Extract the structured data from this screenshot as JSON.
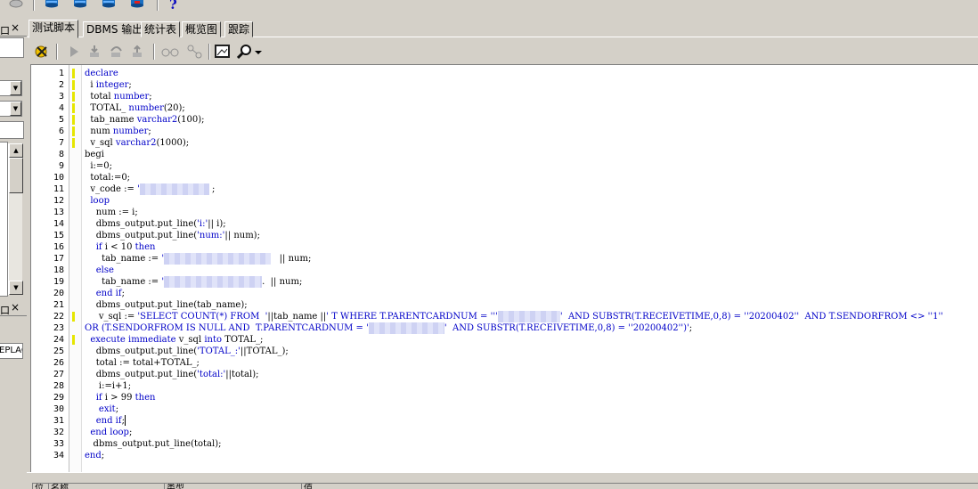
{
  "toolbar": {
    "icons": [
      "disk-icon",
      "database-icon",
      "database-icon",
      "database-icon",
      "database-icon",
      "help-icon"
    ],
    "help_label": "?"
  },
  "left_panel": {
    "top_header_glyph": "口",
    "bottom_header_glyph": "口",
    "close_glyph": "×",
    "replace_tab_label": "EPLAC"
  },
  "tabs": [
    {
      "label": "测试脚本",
      "active": true
    },
    {
      "label": "DBMS 输出",
      "active": false
    },
    {
      "label": "统计表",
      "active": false
    },
    {
      "label": "概览图",
      "active": false
    },
    {
      "label": "跟踪",
      "active": false
    }
  ],
  "editor_toolbar": {
    "icons": [
      "debug-start-icon",
      "run-icon",
      "step-into-icon",
      "step-over-icon",
      "step-out-icon",
      "glasses-icon",
      "breakpoint-icon",
      "image-icon",
      "find-icon",
      "dropdown-arrow-icon"
    ]
  },
  "editor": {
    "modified_lines": [
      1,
      2,
      3,
      4,
      5,
      6,
      7,
      22,
      24
    ],
    "lines": [
      [
        {
          "t": "declare",
          "c": "kw"
        }
      ],
      [
        {
          "t": "  i "
        },
        {
          "t": "integer",
          "c": "kw"
        },
        {
          "t": ";"
        }
      ],
      [
        {
          "t": "  total "
        },
        {
          "t": "number",
          "c": "kw"
        },
        {
          "t": ";"
        }
      ],
      [
        {
          "t": "  TOTAL_ "
        },
        {
          "t": "number",
          "c": "kw"
        },
        {
          "t": "(20);"
        }
      ],
      [
        {
          "t": "  tab_name "
        },
        {
          "t": "varchar2",
          "c": "kw"
        },
        {
          "t": "(100);"
        }
      ],
      [
        {
          "t": "  num "
        },
        {
          "t": "number",
          "c": "kw"
        },
        {
          "t": ";"
        }
      ],
      [
        {
          "t": "  v_sql "
        },
        {
          "t": "varchar2",
          "c": "kw"
        },
        {
          "t": "(1000);"
        }
      ],
      [
        {
          "t": "begi"
        }
      ],
      [
        {
          "t": "  i:=0;"
        }
      ],
      [
        {
          "t": "  total:=0;"
        }
      ],
      [
        {
          "t": "  v_code := "
        },
        {
          "t": "'",
          "c": "str"
        },
        {
          "t": "",
          "blur": 78
        },
        {
          "t": " ;"
        }
      ],
      [
        {
          "t": "  "
        },
        {
          "t": "loop",
          "c": "kw"
        }
      ],
      [
        {
          "t": "    num := i;"
        }
      ],
      [
        {
          "t": "    dbms_output.put_line("
        },
        {
          "t": "'i:'",
          "c": "str"
        },
        {
          "t": "|| i);"
        }
      ],
      [
        {
          "t": "    dbms_output.put_line("
        },
        {
          "t": "'num:'",
          "c": "str"
        },
        {
          "t": "|| num);"
        }
      ],
      [
        {
          "t": "    "
        },
        {
          "t": "if",
          "c": "kw"
        },
        {
          "t": " i < 10 "
        },
        {
          "t": "then",
          "c": "kw"
        }
      ],
      [
        {
          "t": "      tab_name := "
        },
        {
          "t": "'",
          "c": "str"
        },
        {
          "t": "",
          "blur": 120
        },
        {
          "t": "   || num;"
        }
      ],
      [
        {
          "t": "    "
        },
        {
          "t": "else",
          "c": "kw"
        }
      ],
      [
        {
          "t": "      tab_name := "
        },
        {
          "t": "'",
          "c": "str"
        },
        {
          "t": "",
          "blur": 110
        },
        {
          "t": ".  || num;"
        }
      ],
      [
        {
          "t": "    "
        },
        {
          "t": "end if",
          "c": "kw"
        },
        {
          "t": ";"
        }
      ],
      [
        {
          "t": "    dbms_output.put_line(tab_name);"
        }
      ],
      [
        {
          "t": "     v_sql := "
        },
        {
          "t": "'SELECT COUNT(*) FROM  '",
          "c": "str"
        },
        {
          "t": "||tab_name ||"
        },
        {
          "t": "' T WHERE T.PARENTCARDNUM = '''",
          "c": "str"
        },
        {
          "t": "",
          "blur": 70
        },
        {
          "t": "'  AND SUBSTR(T.RECEIVETIME,0,8) = ''20200402''  AND T.SENDORFROM <> ''1''",
          "c": "str"
        }
      ],
      [
        {
          "t": "OR (T.SENDORFROM IS NULL AND  T.PARENTCARDNUM = '",
          "c": "str"
        },
        {
          "t": "",
          "blur": 85
        },
        {
          "t": "'  AND SUBSTR(T.RECEIVETIME,0,8) = ''20200402'')'",
          "c": "str"
        },
        {
          "t": ";"
        }
      ],
      [
        {
          "t": "  "
        },
        {
          "t": "execute immediate",
          "c": "kw"
        },
        {
          "t": " v_sql "
        },
        {
          "t": "into",
          "c": "kw"
        },
        {
          "t": " TOTAL_;"
        }
      ],
      [
        {
          "t": "    dbms_output.put_line("
        },
        {
          "t": "'TOTAL_:'",
          "c": "str"
        },
        {
          "t": "||TOTAL_);"
        }
      ],
      [
        {
          "t": "    total := total+TOTAL_;"
        }
      ],
      [
        {
          "t": "    dbms_output.put_line("
        },
        {
          "t": "'total:'",
          "c": "str"
        },
        {
          "t": "||total);"
        }
      ],
      [
        {
          "t": "     i:=i+1;"
        }
      ],
      [
        {
          "t": "    "
        },
        {
          "t": "if",
          "c": "kw"
        },
        {
          "t": " i > 99 "
        },
        {
          "t": "then",
          "c": "kw"
        }
      ],
      [
        {
          "t": "     "
        },
        {
          "t": "exit",
          "c": "kw"
        },
        {
          "t": ";"
        }
      ],
      [
        {
          "t": "    "
        },
        {
          "t": "end if",
          "c": "kw"
        },
        {
          "t": ";"
        },
        {
          "t": "",
          "caret": true
        }
      ],
      [
        {
          "t": "  "
        },
        {
          "t": "end loop",
          "c": "kw"
        },
        {
          "t": ";"
        }
      ],
      [
        {
          "t": "   dbms_output.put_line(total);"
        }
      ],
      [
        {
          "t": "end",
          "c": "kw"
        },
        {
          "t": ";"
        }
      ]
    ]
  },
  "bottom_grid": {
    "headers": [
      "位",
      "名称",
      "类型",
      "值"
    ]
  }
}
